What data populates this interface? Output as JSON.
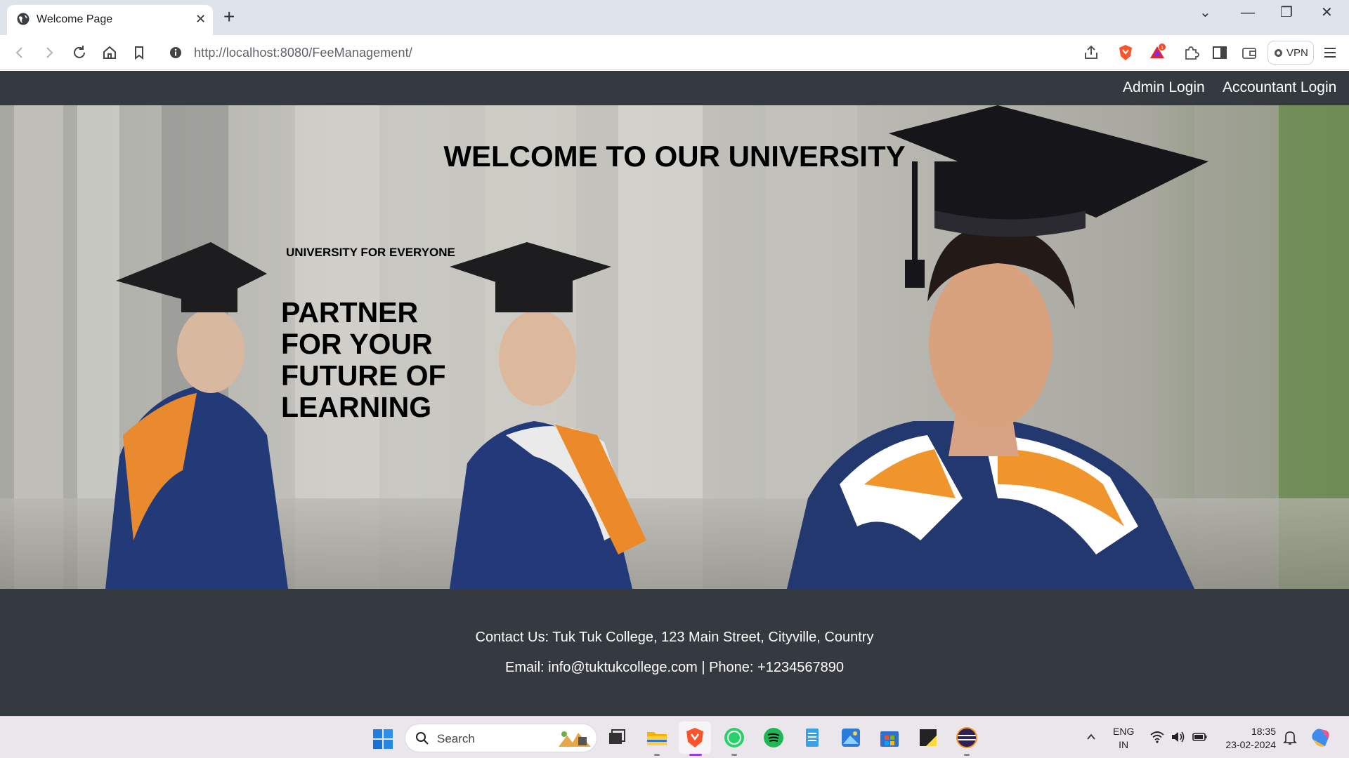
{
  "browser": {
    "tab_title": "Welcome Page",
    "tab_close": "✕",
    "new_tab": "+",
    "url_host": "http://localhost",
    "url_path": ":8080/FeeManagement/",
    "vpn_label": "VPN",
    "notification_badge": "1"
  },
  "window_controls": {
    "chevron": "⌄",
    "minimize": "—",
    "restore": "❐",
    "close": "✕"
  },
  "nav": {
    "admin_login": "Admin Login",
    "accountant_login": "Accountant Login"
  },
  "hero": {
    "title": "WELCOME TO OUR UNIVERSITY",
    "subtitle": "UNIVERSITY FOR EVERYONE",
    "tagline": "PARTNER FOR YOUR FUTURE OF LEARNING"
  },
  "footer": {
    "contact_line": "Contact Us: Tuk Tuk College, 123 Main Street, Cityville, Country",
    "email_line": "Email: info@tuktukcollege.com | Phone: +1234567890"
  },
  "taskbar": {
    "search_label": "Search",
    "lang_top": "ENG",
    "lang_bottom": "IN",
    "time": "18:35",
    "date": "23-02-2024",
    "apps": [
      "file-explorer-icon",
      "brave-icon",
      "whatsapp-icon",
      "spotify-icon",
      "notepad-icon",
      "photos-icon",
      "store-icon",
      "sticky-notes-icon",
      "eclipse-icon"
    ]
  },
  "colors": {
    "navbar_bg": "#343a40",
    "footer_bg": "#343a40",
    "nav_text": "#ffffff",
    "hero_text": "#000000"
  }
}
